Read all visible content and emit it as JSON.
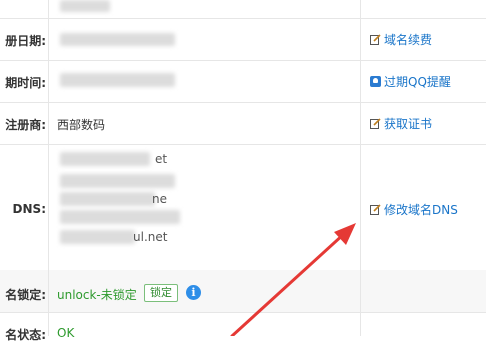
{
  "rows": {
    "reg_date": {
      "label": "册日期:"
    },
    "expire": {
      "label": "期时间:"
    },
    "registrar": {
      "label": "注册商:",
      "value": "西部数码"
    },
    "dns": {
      "label": "DNS:",
      "fragments": [
        "et",
        "ne",
        "ul.net"
      ]
    },
    "lock": {
      "label": "名锁定:",
      "value": "unlock-未锁定",
      "button": "锁定"
    },
    "status": {
      "label": "名状态:",
      "value": "OK"
    }
  },
  "actions": {
    "renew": "域名续费",
    "qq_reminder": "过期QQ提醒",
    "certificate": "获取证书",
    "modify_dns": "修改域名DNS"
  },
  "colors": {
    "link": "#1a75c9",
    "ok_green": "#2e9a2e",
    "annotation_arrow": "#e53935"
  }
}
